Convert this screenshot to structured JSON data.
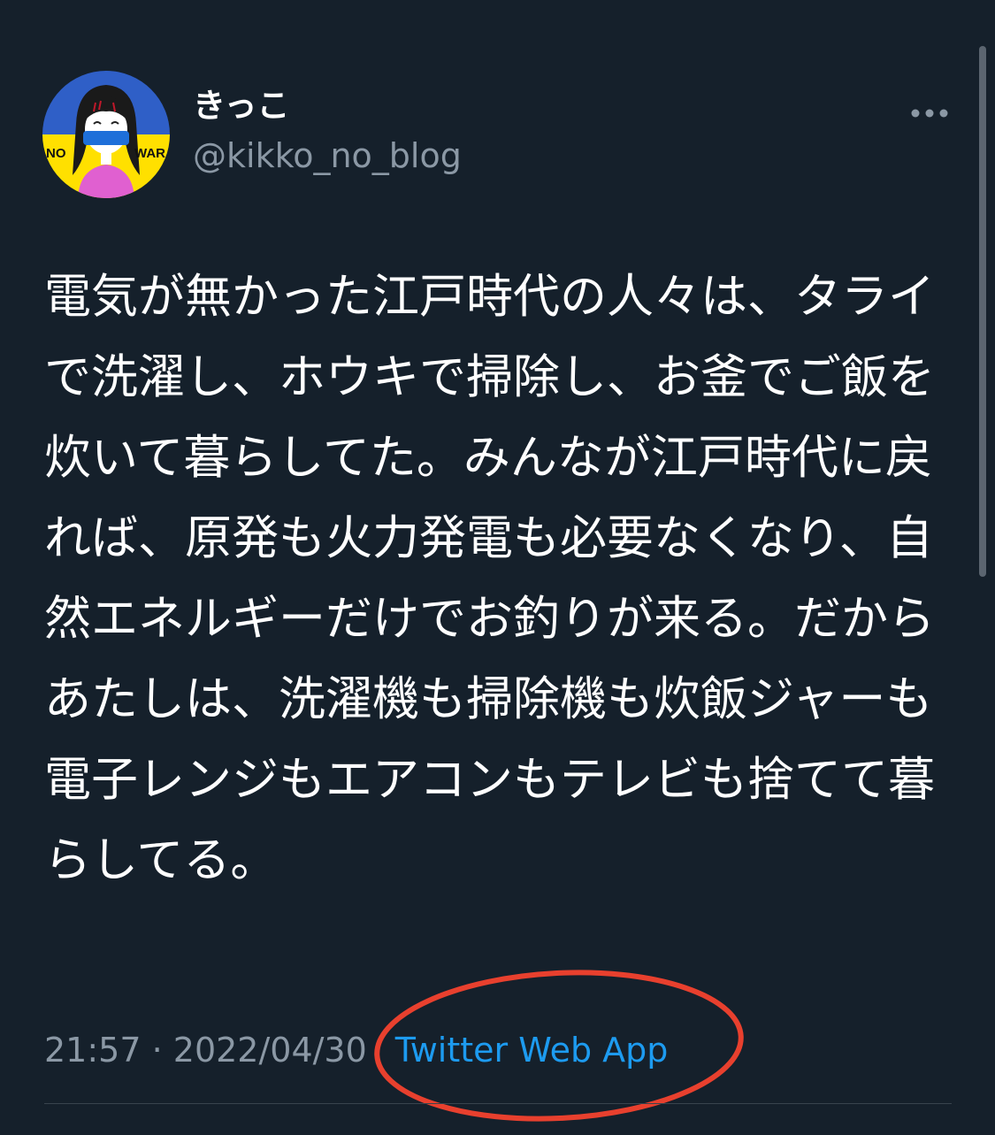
{
  "tweet": {
    "author": {
      "display_name": "きっこ",
      "handle": "@kikko_no_blog",
      "avatar": {
        "icon": "avatar-no-war-icon",
        "badge_left": "NO",
        "badge_right": "WAR",
        "colors": {
          "top": "#2f5fc7",
          "bottom": "#ffe000",
          "mask": "#1e6fd9"
        }
      }
    },
    "text": "電気が無かった江戸時代の人々は、タライで洗濯し、ホウキで掃除し、お釜でご飯を炊いて暮らしてた。みんなが江戸時代に戻れば、原発も火力発電も必要なくなり、自然エネルギーだけでお釣りが来る。だからあたしは、洗濯機も掃除機も炊飯ジャーも電子レンジもエアコンもテレビも捨てて暮らしてる。",
    "time": "21:57",
    "separator": " · ",
    "date": "2022/04/30",
    "source": "Twitter Web App"
  },
  "colors": {
    "background": "#15202b",
    "text": "#ffffff",
    "muted": "#8b98a5",
    "link": "#1d9bf0",
    "annotation": "#e8402e",
    "divider": "#38444d"
  },
  "icons": {
    "more": "more-horizontal-icon",
    "annotation": "red-ellipse-annotation"
  }
}
